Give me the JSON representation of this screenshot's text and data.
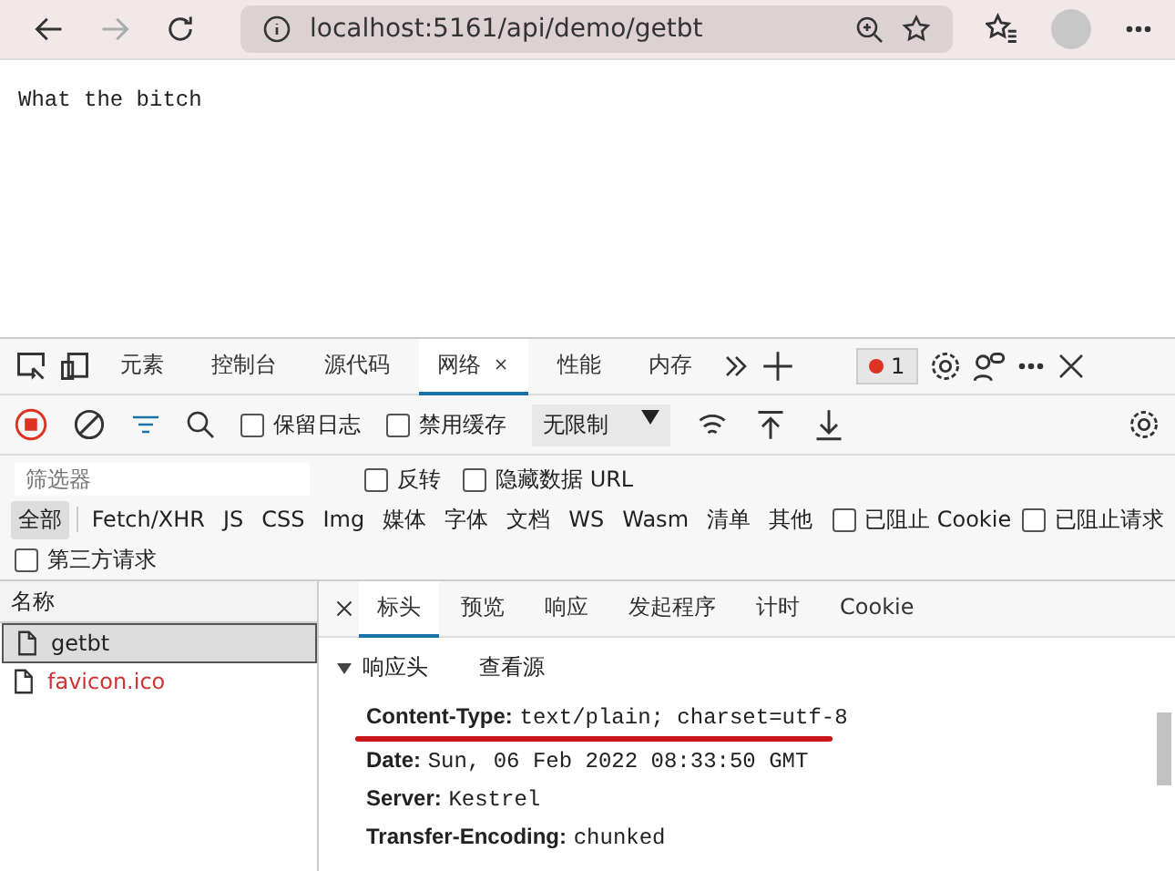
{
  "browser": {
    "back_disabled": false,
    "forward_disabled": true,
    "url": "localhost:5161/api/demo/getbt"
  },
  "page": {
    "text": "What the bitch"
  },
  "devtools": {
    "tabs": [
      {
        "label": "元素",
        "selected": false
      },
      {
        "label": "控制台",
        "selected": false
      },
      {
        "label": "源代码",
        "selected": false
      },
      {
        "label": "网络",
        "selected": true
      },
      {
        "label": "性能",
        "selected": false
      },
      {
        "label": "内存",
        "selected": false
      }
    ],
    "error_count": "1",
    "toolbar": {
      "recording": true,
      "checks": [
        {
          "label": "保留日志",
          "checked": false
        },
        {
          "label": "禁用缓存",
          "checked": false
        }
      ],
      "throttle": "无限制"
    },
    "filter": {
      "placeholder": "筛选器",
      "checks": [
        {
          "label": "反转",
          "checked": false
        },
        {
          "label": "隐藏数据 URL",
          "checked": false
        }
      ]
    },
    "type_filters": [
      {
        "label": "全部",
        "selected": true
      },
      {
        "label": "Fetch/XHR",
        "selected": false
      },
      {
        "label": "JS",
        "selected": false
      },
      {
        "label": "CSS",
        "selected": false
      },
      {
        "label": "Img",
        "selected": false
      },
      {
        "label": "媒体",
        "selected": false
      },
      {
        "label": "字体",
        "selected": false
      },
      {
        "label": "文档",
        "selected": false
      },
      {
        "label": "WS",
        "selected": false
      },
      {
        "label": "Wasm",
        "selected": false
      },
      {
        "label": "清单",
        "selected": false
      },
      {
        "label": "其他",
        "selected": false
      }
    ],
    "extra_checks": [
      {
        "label": "已阻止 Cookie",
        "checked": false
      },
      {
        "label": "已阻止请求",
        "checked": false
      },
      {
        "label": "第三方请求",
        "checked": false
      }
    ],
    "requests": {
      "column": "名称",
      "rows": [
        {
          "name": "getbt",
          "selected": true,
          "failed": false
        },
        {
          "name": "favicon.ico",
          "selected": false,
          "failed": true
        }
      ]
    },
    "detail_tabs": [
      {
        "label": "标头",
        "selected": true
      },
      {
        "label": "预览",
        "selected": false
      },
      {
        "label": "响应",
        "selected": false
      },
      {
        "label": "发起程序",
        "selected": false
      },
      {
        "label": "计时",
        "selected": false
      },
      {
        "label": "Cookie",
        "selected": false
      }
    ],
    "section": {
      "title": "响应头",
      "expanded": true,
      "view_source": "查看源"
    },
    "headers": [
      {
        "name": "Content-Type:",
        "value": "text/plain; charset=utf-8",
        "underlined": true
      },
      {
        "name": "Date:",
        "value": "Sun, 06 Feb 2022 08:33:50 GMT",
        "underlined": false
      },
      {
        "name": "Server:",
        "value": "Kestrel",
        "underlined": false
      },
      {
        "name": "Transfer-Encoding:",
        "value": "chunked",
        "underlined": false
      }
    ]
  }
}
